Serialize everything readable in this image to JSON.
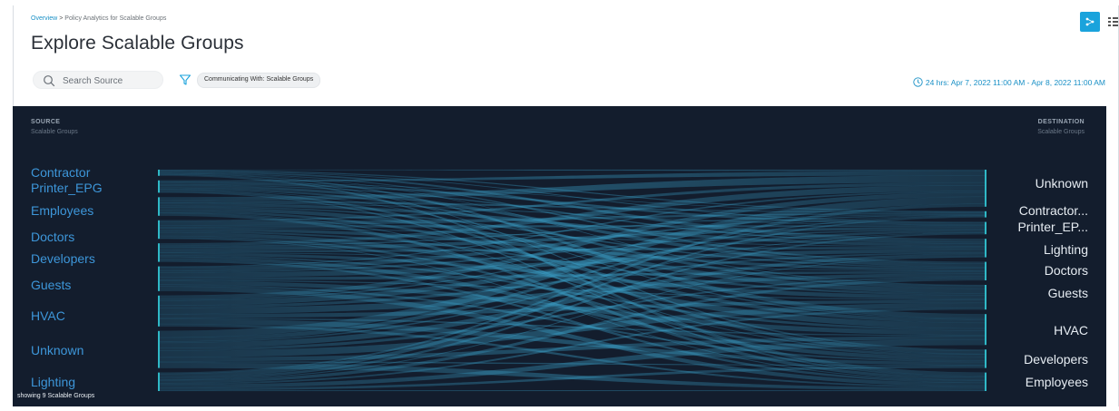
{
  "breadcrumb": {
    "link": "Overview",
    "separator": ">",
    "current": "Policy Analytics for Scalable Groups"
  },
  "page": {
    "title": "Explore Scalable Groups"
  },
  "search": {
    "placeholder": "Search Source",
    "icon": "search-icon"
  },
  "filter": {
    "icon": "filter-icon",
    "chip_label": "Communicating With: Scalable Groups"
  },
  "time_range": {
    "icon": "clock-icon",
    "text": "24 hrs:  Apr 7, 2022 11:00 AM - Apr 8, 2022 11:00 AM"
  },
  "view_toggle": {
    "graph_icon": "graph-view-icon",
    "table_icon": "table-view-icon",
    "active": "graph"
  },
  "colors": {
    "accent": "#1aa3dc",
    "panel_bg": "#131d2d",
    "source_label": "#3d96d9",
    "node_bar": "#2fb8c6",
    "flow": "#3aa0c8"
  },
  "source": {
    "heading": "SOURCE",
    "subheading": "Scalable Groups",
    "nodes": [
      {
        "label": "Contractor",
        "weight": 1
      },
      {
        "label": "Printer_EPG",
        "weight": 2
      },
      {
        "label": "Employees",
        "weight": 3
      },
      {
        "label": "Doctors",
        "weight": 3
      },
      {
        "label": "Developers",
        "weight": 3
      },
      {
        "label": "Guests",
        "weight": 4
      },
      {
        "label": "HVAC",
        "weight": 5
      },
      {
        "label": "Unknown",
        "weight": 6
      },
      {
        "label": "Lighting",
        "weight": 3
      }
    ]
  },
  "destination": {
    "heading": "DESTINATION",
    "subheading": "Scalable Groups",
    "nodes": [
      {
        "label": "Unknown",
        "weight": 6
      },
      {
        "label": "Contractor...",
        "weight": 1
      },
      {
        "label": "Printer_EP...",
        "weight": 2
      },
      {
        "label": "Lighting",
        "weight": 3
      },
      {
        "label": "Doctors",
        "weight": 3
      },
      {
        "label": "Guests",
        "weight": 4
      },
      {
        "label": "HVAC",
        "weight": 5
      },
      {
        "label": "Developers",
        "weight": 3
      },
      {
        "label": "Employees",
        "weight": 3
      }
    ]
  },
  "footer": {
    "showing": "showing 9 Scalable Groups"
  }
}
